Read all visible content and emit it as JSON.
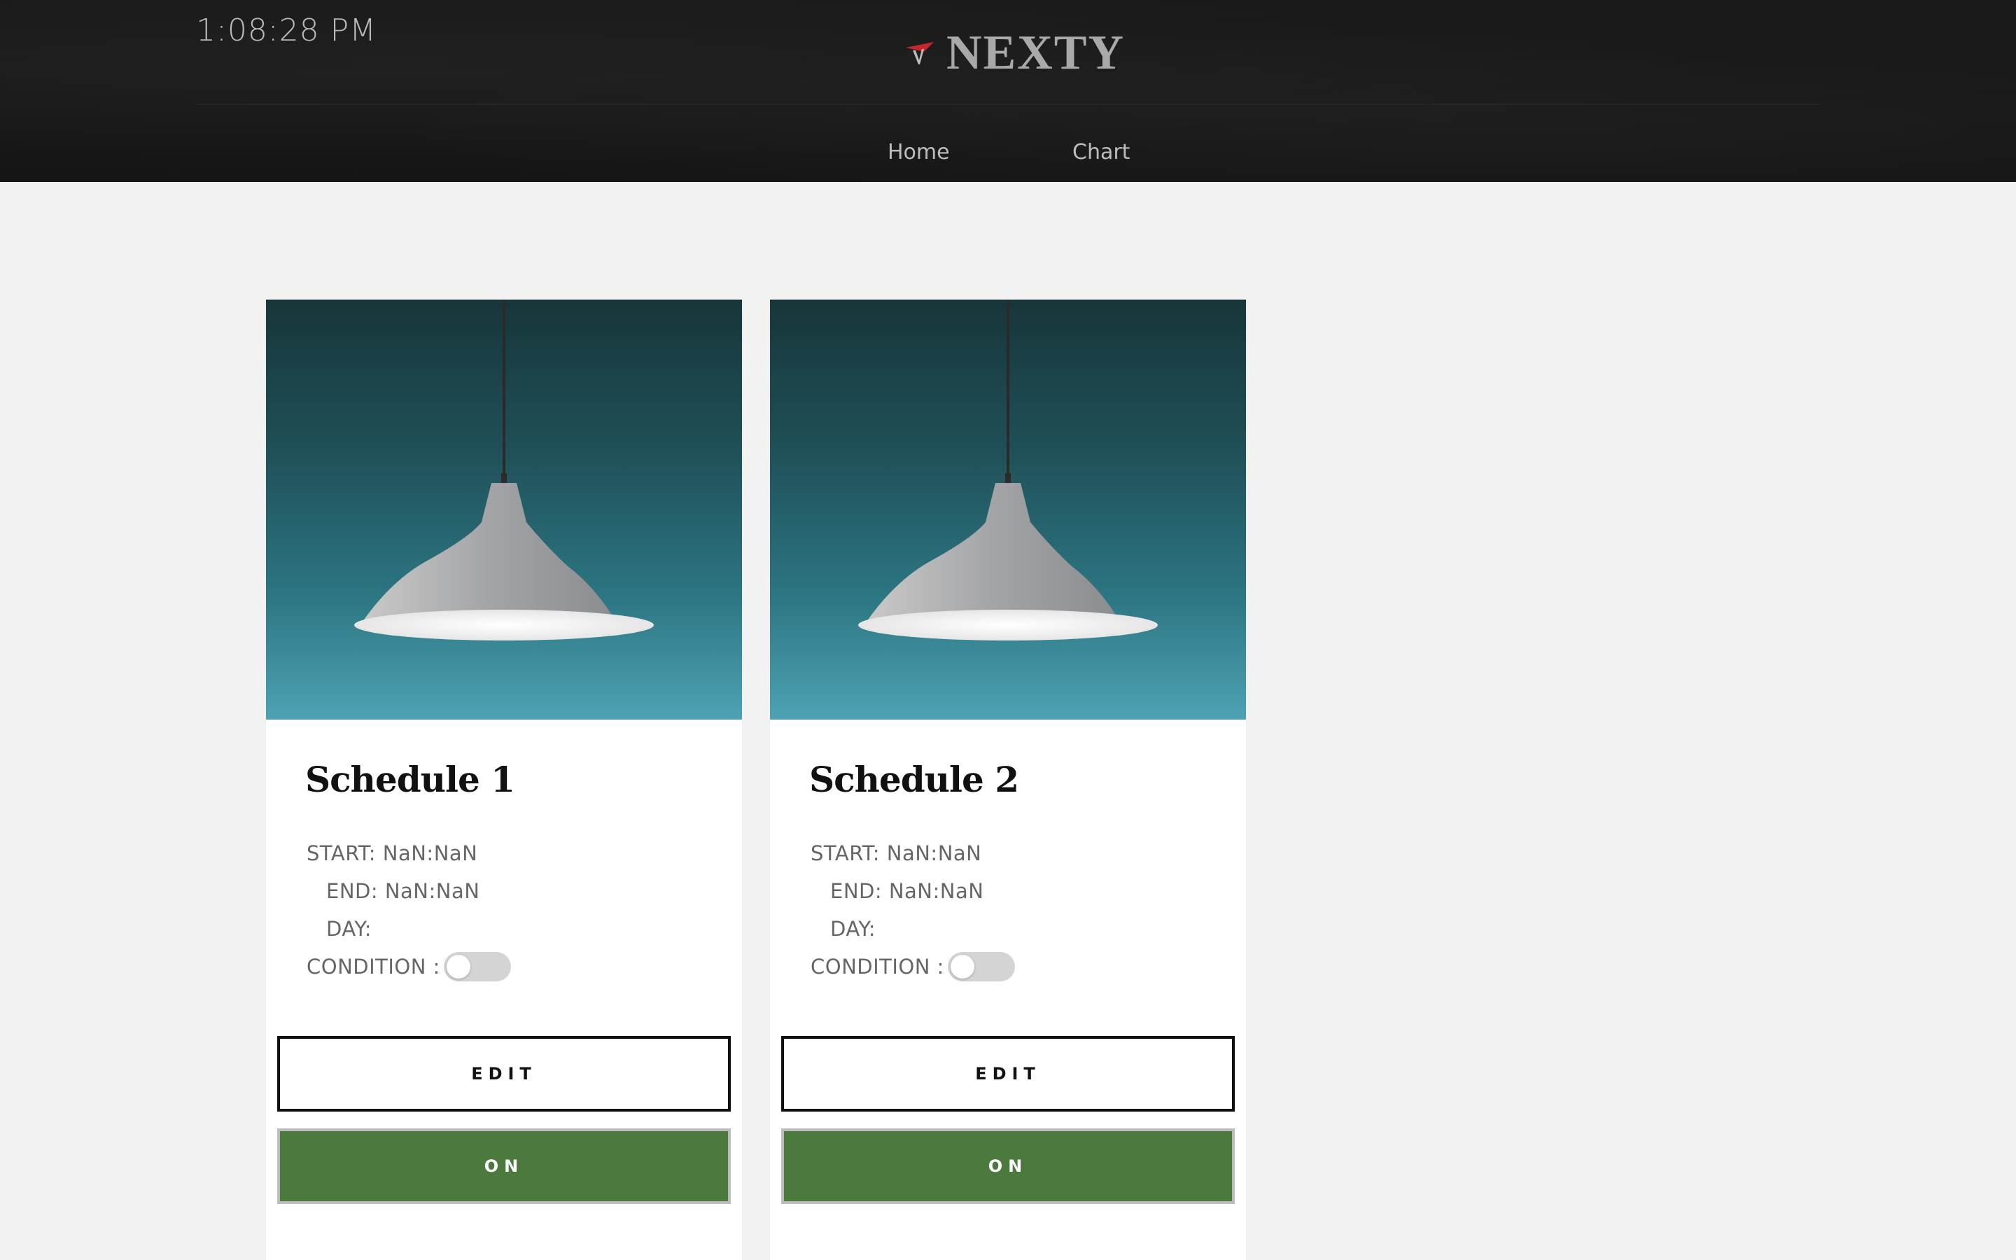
{
  "header": {
    "clock": "1:08:28 PM",
    "brand": "NEXTY",
    "nav": [
      {
        "label": "Home"
      },
      {
        "label": "Chart"
      }
    ]
  },
  "schedules": [
    {
      "title": "Schedule 1",
      "start": "START: NaN:NaN",
      "end": "END: NaN:NaN",
      "day": "DAY:",
      "condition_label": "CONDITION :",
      "condition_on": false,
      "edit_label": "EDIT",
      "power_label": "ON"
    },
    {
      "title": "Schedule 2",
      "start": "START: NaN:NaN",
      "end": "END: NaN:NaN",
      "day": "DAY:",
      "condition_label": "CONDITION :",
      "condition_on": false,
      "edit_label": "EDIT",
      "power_label": "ON"
    }
  ],
  "colors": {
    "header_bg": "#1b1b1b",
    "page_bg": "#f2f2f2",
    "on_button": "#4b793e",
    "toggle_off": "#d4d4d4",
    "logo_accent": "#c62828"
  }
}
